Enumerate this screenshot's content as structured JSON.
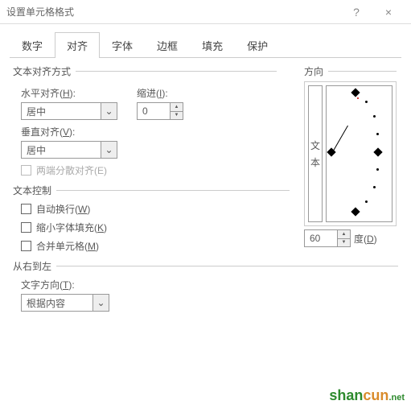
{
  "titlebar": {
    "title": "设置单元格格式",
    "help": "?",
    "close": "×"
  },
  "tabs": [
    "数字",
    "对齐",
    "字体",
    "边框",
    "填充",
    "保护"
  ],
  "active_tab": 1,
  "align": {
    "section": "文本对齐方式",
    "h_label": "水平对齐(H):",
    "h_value": "居中",
    "v_label": "垂直对齐(V):",
    "v_value": "居中",
    "indent_label": "缩进(I):",
    "indent_value": "0",
    "justify": "两端分散对齐(E)"
  },
  "textctrl": {
    "section": "文本控制",
    "wrap": "自动换行(W)",
    "shrink": "缩小字体填充(K)",
    "merge": "合并单元格(M)"
  },
  "rtl": {
    "section": "从右到左",
    "dir_label": "文字方向(T):",
    "dir_value": "根据内容"
  },
  "orient": {
    "section": "方向",
    "vtext1": "文",
    "vtext2": "本",
    "degree_value": "60",
    "degree_label": "度(D)"
  },
  "watermark": {
    "a": "shan",
    "b": "cun",
    "c": ".net"
  }
}
